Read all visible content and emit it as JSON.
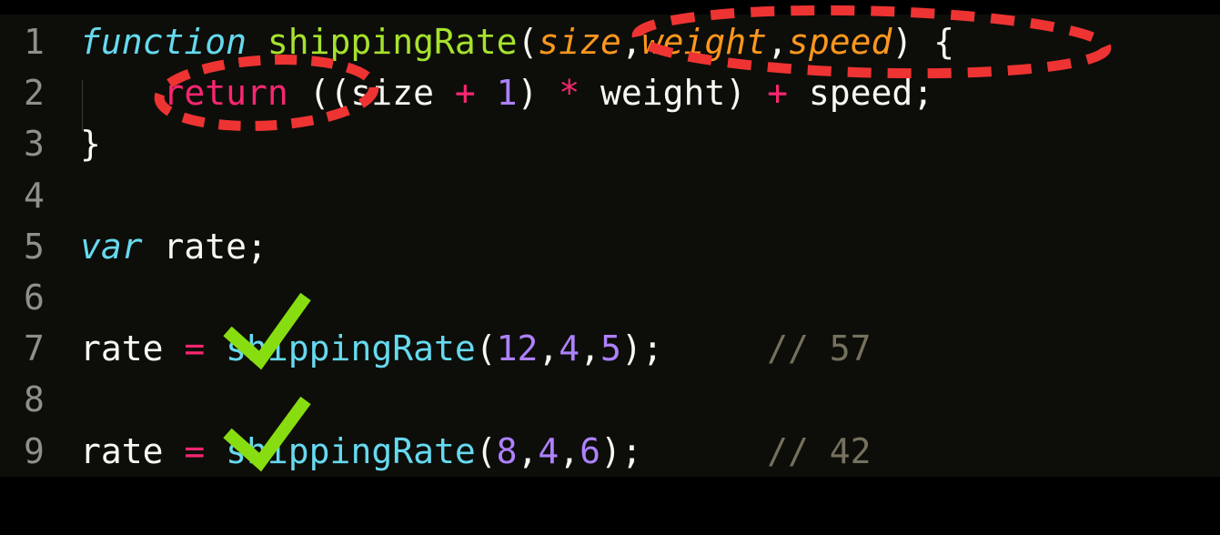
{
  "editor": {
    "lines": [
      {
        "number": "1",
        "tokens": [
          {
            "text": "function",
            "role": "keyword-storage"
          },
          {
            "text": " ",
            "role": "plain"
          },
          {
            "text": "shippingRate",
            "role": "function-name"
          },
          {
            "text": "(",
            "role": "plain"
          },
          {
            "text": "size",
            "role": "parameter"
          },
          {
            "text": ",",
            "role": "plain"
          },
          {
            "text": "weight",
            "role": "parameter"
          },
          {
            "text": ",",
            "role": "plain"
          },
          {
            "text": "speed",
            "role": "parameter"
          },
          {
            "text": ") {",
            "role": "plain"
          }
        ]
      },
      {
        "number": "2",
        "tokens": [
          {
            "text": "    ",
            "role": "plain"
          },
          {
            "text": "return",
            "role": "keyword"
          },
          {
            "text": " ((size ",
            "role": "plain"
          },
          {
            "text": "+",
            "role": "keyword"
          },
          {
            "text": " ",
            "role": "plain"
          },
          {
            "text": "1",
            "role": "number"
          },
          {
            "text": ") ",
            "role": "plain"
          },
          {
            "text": "*",
            "role": "keyword"
          },
          {
            "text": " weight) ",
            "role": "plain"
          },
          {
            "text": "+",
            "role": "keyword"
          },
          {
            "text": " speed;",
            "role": "plain"
          }
        ]
      },
      {
        "number": "3",
        "tokens": [
          {
            "text": "}",
            "role": "plain"
          }
        ]
      },
      {
        "number": "4",
        "tokens": []
      },
      {
        "number": "5",
        "tokens": [
          {
            "text": "var",
            "role": "keyword-storage"
          },
          {
            "text": " rate;",
            "role": "plain"
          }
        ]
      },
      {
        "number": "6",
        "tokens": []
      },
      {
        "number": "7",
        "tokens": [
          {
            "text": "rate ",
            "role": "plain"
          },
          {
            "text": "=",
            "role": "keyword"
          },
          {
            "text": " ",
            "role": "plain"
          },
          {
            "text": "shippingRate",
            "role": "call"
          },
          {
            "text": "(",
            "role": "plain"
          },
          {
            "text": "12",
            "role": "number"
          },
          {
            "text": ",",
            "role": "plain"
          },
          {
            "text": "4",
            "role": "number"
          },
          {
            "text": ",",
            "role": "plain"
          },
          {
            "text": "5",
            "role": "number"
          },
          {
            "text": ");     ",
            "role": "plain"
          },
          {
            "text": "// 57",
            "role": "comment"
          }
        ]
      },
      {
        "number": "8",
        "tokens": []
      },
      {
        "number": "9",
        "tokens": [
          {
            "text": "rate ",
            "role": "plain"
          },
          {
            "text": "=",
            "role": "keyword"
          },
          {
            "text": " ",
            "role": "plain"
          },
          {
            "text": "shippingRate",
            "role": "call"
          },
          {
            "text": "(",
            "role": "plain"
          },
          {
            "text": "8",
            "role": "number"
          },
          {
            "text": ",",
            "role": "plain"
          },
          {
            "text": "4",
            "role": "number"
          },
          {
            "text": ",",
            "role": "plain"
          },
          {
            "text": "6",
            "role": "number"
          },
          {
            "text": ");      ",
            "role": "plain"
          },
          {
            "text": "// 42",
            "role": "comment"
          }
        ]
      }
    ]
  },
  "colors": {
    "background": "#0d0e09",
    "keyword": "#f92672",
    "keyword_storage": "#66d9ef",
    "function_name": "#a6e22e",
    "parameter": "#fd971f",
    "number": "#ae81ff",
    "comment": "#75715e",
    "plain": "#f8f8f2",
    "annotation_circle": "#ee3333",
    "annotation_check": "#88dd11"
  },
  "annotations": {
    "circles": [
      "parameters-circle",
      "return-circle"
    ],
    "checkmarks": [
      "line-7-check",
      "line-9-check"
    ]
  }
}
